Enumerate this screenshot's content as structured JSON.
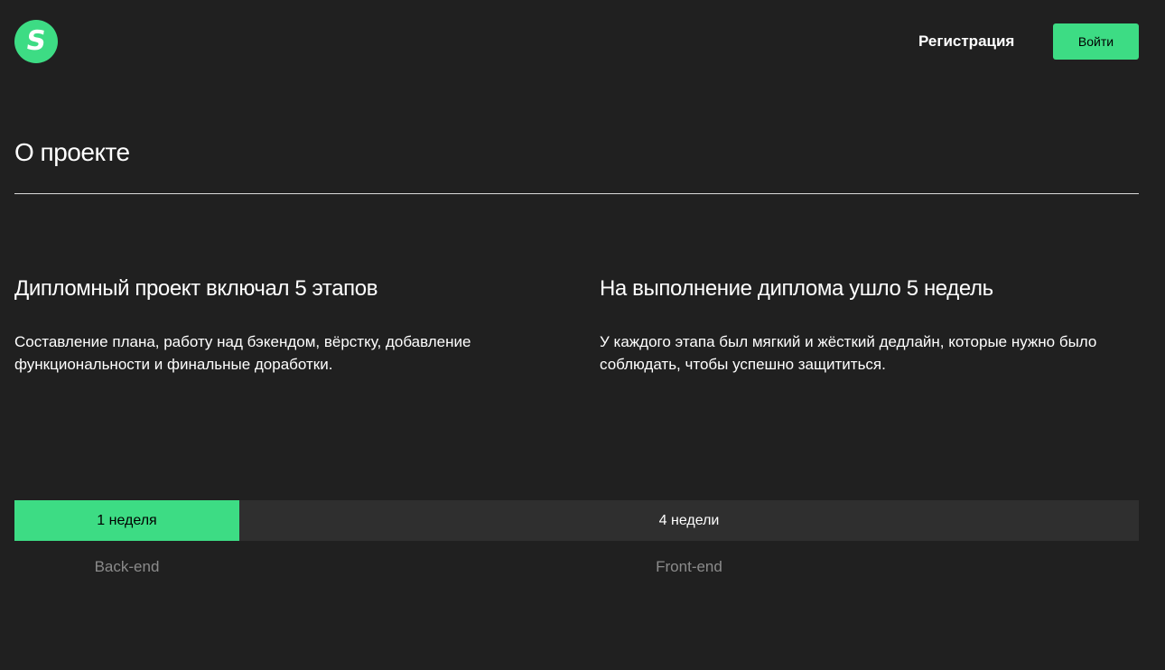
{
  "header": {
    "logo_letter": "S",
    "register_label": "Регистрация",
    "login_label": "Войти"
  },
  "about": {
    "title": "О проекте",
    "columns": [
      {
        "heading": "Дипломный проект включал 5 этапов",
        "text": "Составление плана, работу над бэкендом, вёрстку, добавление функциональности и финальные доработки."
      },
      {
        "heading": "На выполнение диплома ушло 5 недель",
        "text": "У каждого этапа был мягкий и жёсткий дедлайн, которые нужно было соблюдать, чтобы успешно защититься."
      }
    ]
  },
  "timeline": {
    "segments": [
      {
        "duration": "1 неделя",
        "label": "Back-end",
        "weeks": 1
      },
      {
        "duration": "4 недели",
        "label": "Front-end",
        "weeks": 4
      }
    ]
  },
  "colors": {
    "background": "#202020",
    "accent": "#3ddc84",
    "bar_dark": "#2f2f2f",
    "muted_text": "#8b8b8b"
  }
}
